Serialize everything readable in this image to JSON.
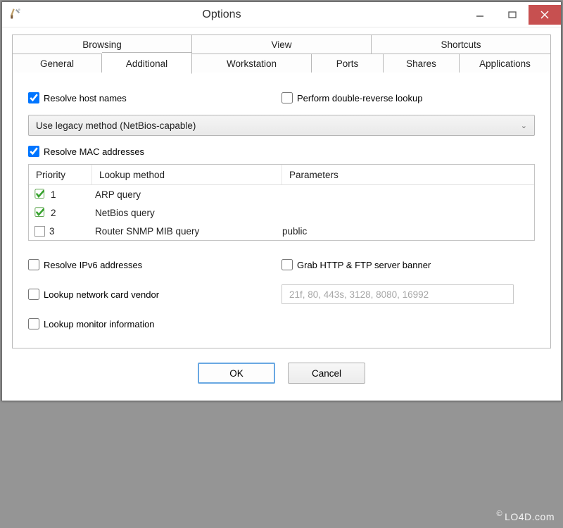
{
  "window": {
    "title": "Options"
  },
  "tabs_top": {
    "t1": "Browsing",
    "t2": "View",
    "t3": "Shortcuts"
  },
  "tabs_bottom": {
    "t1": "General",
    "t2": "Additional",
    "t3": "Workstation",
    "t4": "Ports",
    "t5": "Shares",
    "t6": "Applications"
  },
  "chk": {
    "resolve_host": "Resolve host names",
    "double_reverse": "Perform double-reverse lookup",
    "select_value": "Use legacy method (NetBios-capable)",
    "resolve_mac": "Resolve MAC addresses",
    "resolve_ipv6": "Resolve IPv6 addresses",
    "grab_banner": "Grab HTTP & FTP server banner",
    "lookup_vendor": "Lookup network card vendor",
    "lookup_monitor": "Lookup monitor information"
  },
  "table": {
    "hdr": {
      "priority": "Priority",
      "method": "Lookup method",
      "params": "Parameters"
    },
    "rows": [
      {
        "checked": true,
        "num": "1",
        "method": "ARP query",
        "params": ""
      },
      {
        "checked": true,
        "num": "2",
        "method": "NetBios query",
        "params": ""
      },
      {
        "checked": false,
        "num": "3",
        "method": "Router SNMP MIB query",
        "params": "public"
      }
    ]
  },
  "ports_placeholder": "21f, 80, 443s, 3128, 8080, 16992",
  "buttons": {
    "ok": "OK",
    "cancel": "Cancel"
  },
  "watermark": "LO4D.com"
}
